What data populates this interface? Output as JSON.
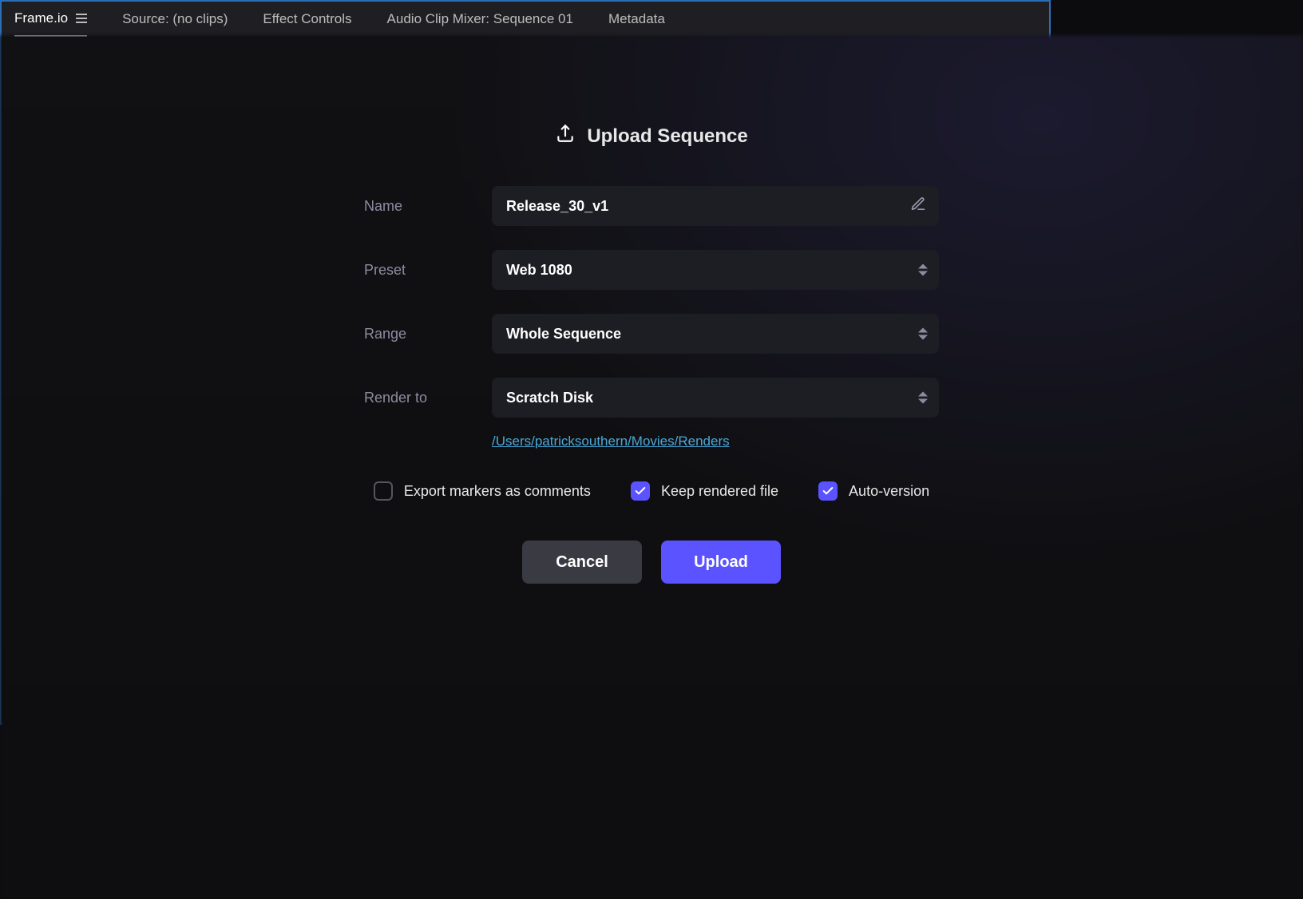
{
  "tabs": {
    "frameio": "Frame.io",
    "source": "Source: (no clips)",
    "effect": "Effect Controls",
    "mixer": "Audio Clip Mixer: Sequence 01",
    "metadata": "Metadata"
  },
  "modal": {
    "title": "Upload Sequence",
    "labels": {
      "name": "Name",
      "preset": "Preset",
      "range": "Range",
      "render_to": "Render to"
    },
    "fields": {
      "name": "Release_30_v1",
      "preset": "Web 1080",
      "range": "Whole Sequence",
      "render_to": "Scratch Disk"
    },
    "render_path": "/Users/patricksouthern/Movies/Renders",
    "checks": {
      "export_markers": "Export markers as comments",
      "keep_rendered": "Keep rendered file",
      "auto_version": "Auto-version"
    },
    "buttons": {
      "cancel": "Cancel",
      "upload": "Upload"
    }
  }
}
